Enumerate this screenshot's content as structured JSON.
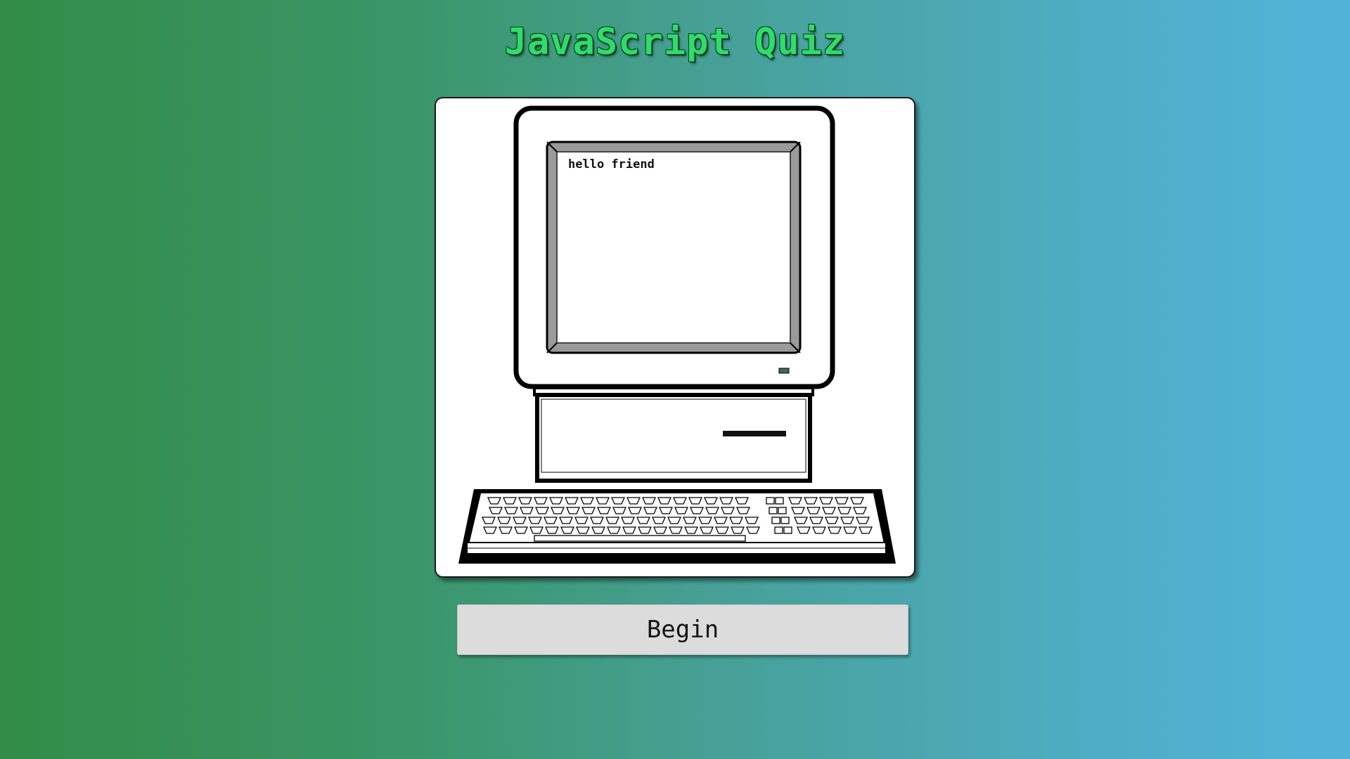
{
  "header": {
    "title": "JavaScript Quiz"
  },
  "illustration": {
    "icon": "retro-computer-icon",
    "screen_text": "hello friend"
  },
  "actions": {
    "begin_label": "Begin"
  },
  "colors": {
    "title": "#2fdc6a",
    "background_start": "#328c47",
    "background_end": "#52b3d8",
    "button_bg": "#dcdcdc"
  }
}
